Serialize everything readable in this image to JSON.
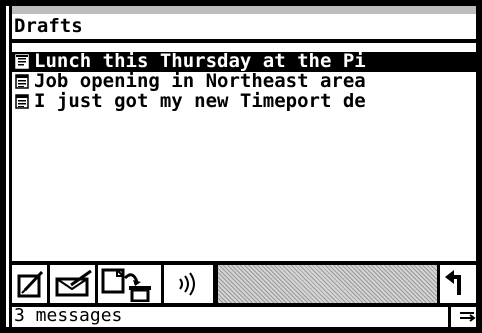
{
  "window": {
    "title": "Drafts"
  },
  "messages": [
    {
      "subject": "Lunch this Thursday at the Pi",
      "selected": true
    },
    {
      "subject": "Job opening in Northeast area",
      "selected": false
    },
    {
      "subject": "I just got my new Timeport de",
      "selected": false
    }
  ],
  "toolbar": {
    "buttons": [
      {
        "icon": "compose-icon"
      },
      {
        "icon": "send-envelope-icon"
      },
      {
        "icon": "delete-to-trash-icon"
      },
      {
        "icon": "speaker-sound-icon"
      },
      {
        "icon": "back-arrow-icon"
      }
    ]
  },
  "status": {
    "text": "3 messages"
  }
}
